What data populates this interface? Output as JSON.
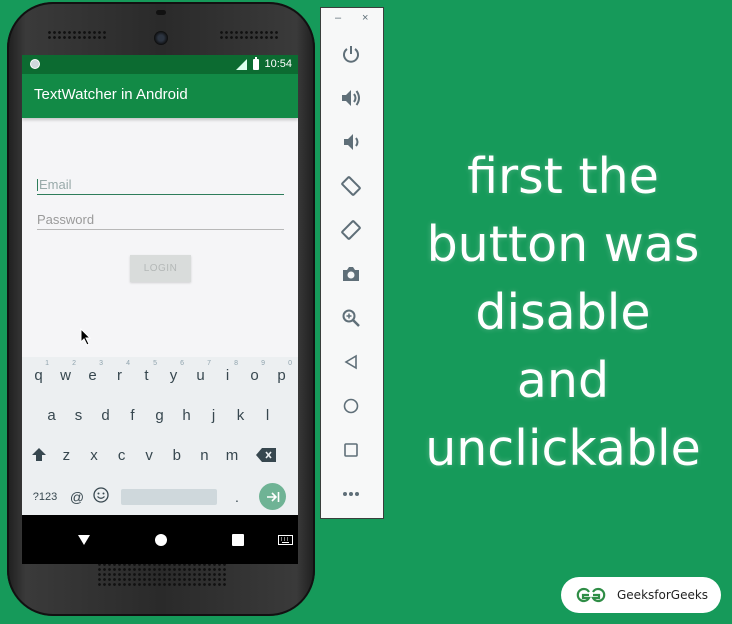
{
  "colors": {
    "background": "#169a5a",
    "app_bar": "#128a46",
    "status_bar": "#0c6b31",
    "accent": "#2e7d5b"
  },
  "status_bar": {
    "time": "10:54"
  },
  "app": {
    "title": "TextWatcher in Android",
    "email_placeholder": "Email",
    "password_placeholder": "Password",
    "login_label": "LOGIN",
    "login_enabled": false
  },
  "keyboard": {
    "row1": [
      {
        "key": "q",
        "hint": "1"
      },
      {
        "key": "w",
        "hint": "2"
      },
      {
        "key": "e",
        "hint": "3"
      },
      {
        "key": "r",
        "hint": "4"
      },
      {
        "key": "t",
        "hint": "5"
      },
      {
        "key": "y",
        "hint": "6"
      },
      {
        "key": "u",
        "hint": "7"
      },
      {
        "key": "i",
        "hint": "8"
      },
      {
        "key": "o",
        "hint": "9"
      },
      {
        "key": "p",
        "hint": "0"
      }
    ],
    "row2": [
      "a",
      "s",
      "d",
      "f",
      "g",
      "h",
      "j",
      "k",
      "l"
    ],
    "row3": [
      "z",
      "x",
      "c",
      "v",
      "b",
      "n",
      "m"
    ],
    "symbols_label": "?123",
    "at_label": "@",
    "period_label": "."
  },
  "emulator_toolbar": {
    "minimize": "–",
    "close": "×",
    "buttons": [
      "power-icon",
      "volume-up-icon",
      "volume-down-icon",
      "rotate-left-icon",
      "rotate-right-icon",
      "camera-icon",
      "zoom-icon",
      "back-icon",
      "home-icon",
      "overview-icon",
      "more-icon"
    ]
  },
  "caption_lines": [
    "first the",
    "button was",
    "disable",
    "and",
    "unclickable"
  ],
  "brand": {
    "name": "GeeksforGeeks"
  }
}
